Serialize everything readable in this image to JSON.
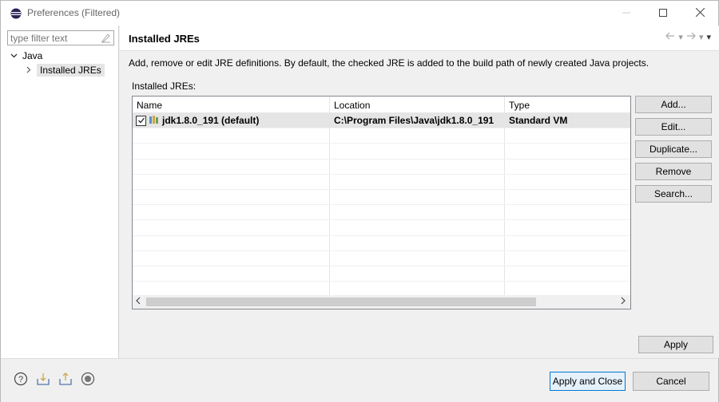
{
  "window": {
    "title": "Preferences (Filtered)",
    "app_icon": "eclipse-icon",
    "controls": [
      "minimize-icon",
      "maximize-icon",
      "close-icon"
    ]
  },
  "sidebar": {
    "filter_placeholder": "type filter text",
    "tree": [
      {
        "label": "Java",
        "expanded": true
      },
      {
        "label": "Installed JREs",
        "selected": true
      }
    ]
  },
  "page": {
    "title": "Installed JREs",
    "description": "Add, remove or edit JRE definitions. By default, the checked JRE is added to the build path of newly created Java projects.",
    "table_label": "Installed JREs:",
    "columns": [
      "Name",
      "Location",
      "Type"
    ],
    "rows": [
      {
        "name": "jdk1.8.0_191 (default)",
        "location": "C:\\Program Files\\Java\\jdk1.8.0_191",
        "type": "Standard VM",
        "checked": true
      }
    ],
    "buttons": {
      "add": "Add...",
      "edit": "Edit...",
      "duplicate": "Duplicate...",
      "remove": "Remove",
      "search": "Search...",
      "apply": "Apply"
    }
  },
  "footer": {
    "apply_close": "Apply and Close",
    "cancel": "Cancel",
    "icons": [
      "help-icon",
      "import-icon",
      "export-icon",
      "record-icon"
    ]
  },
  "colors": {
    "selection": "#e5e5e5",
    "default_button_border": "#0078d7"
  }
}
